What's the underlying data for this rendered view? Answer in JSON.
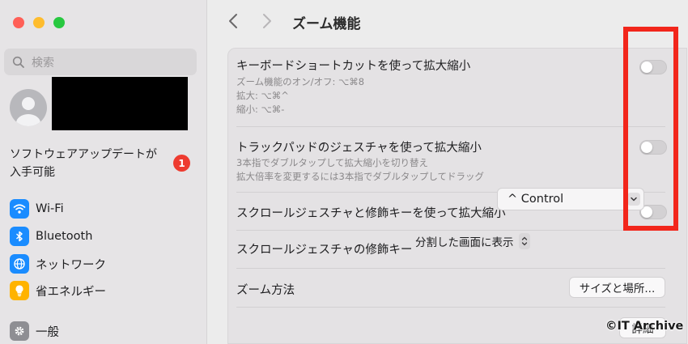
{
  "sidebar": {
    "search_placeholder": "検索",
    "update_text_line1": "ソフトウェアアップデートが",
    "update_text_line2": "入手可能",
    "update_badge": "1",
    "items": [
      {
        "label": "Wi-Fi",
        "icon": "wifi-icon",
        "color": "#1a8cff"
      },
      {
        "label": "Bluetooth",
        "icon": "bluetooth-icon",
        "color": "#1a8cff"
      },
      {
        "label": "ネットワーク",
        "icon": "globe-icon",
        "color": "#1a8cff"
      },
      {
        "label": "省エネルギー",
        "icon": "lightbulb-icon",
        "color": "#ffb300"
      },
      {
        "label": "一般",
        "icon": "gear-icon",
        "color": "#8e8e93"
      }
    ]
  },
  "header": {
    "title": "ズーム機能"
  },
  "settings": {
    "keyboard": {
      "title": "キーボードショートカットを使って拡大縮小",
      "lines": [
        "ズーム機能のオン/オフ: ⌥⌘8",
        "拡大: ⌥⌘^",
        "縮小: ⌥⌘-"
      ],
      "enabled": false
    },
    "trackpad": {
      "title": "トラックパッドのジェスチャを使って拡大縮小",
      "lines": [
        "3本指でダブルタップして拡大縮小を切り替え",
        "拡大倍率を変更するには3本指でダブルタップしてドラッグ"
      ],
      "enabled": false
    },
    "scroll": {
      "title": "スクロールジェスチャと修飾キーを使って拡大縮小",
      "enabled": false
    },
    "modifier": {
      "label": "スクロールジェスチャの修飾キー",
      "value": "^ Control"
    },
    "zoom_method": {
      "label": "ズーム方法",
      "value": "分割した画面に表示",
      "button": "サイズと場所..."
    },
    "partial_button": "詳細"
  },
  "highlight_color": "#f2261b",
  "watermark": "©IT Archive"
}
